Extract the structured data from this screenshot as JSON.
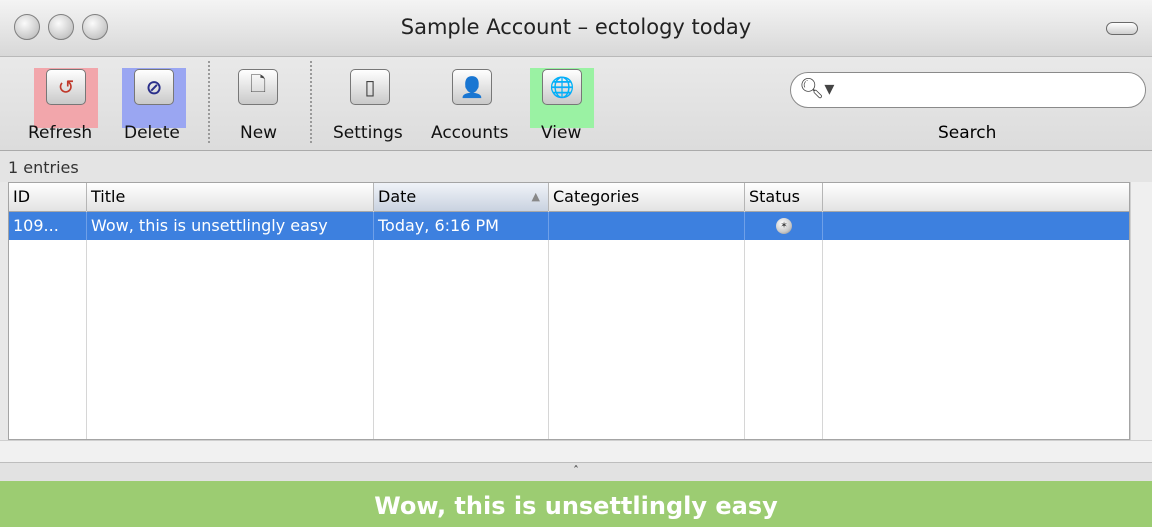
{
  "window": {
    "title": "Sample Account – ectology today"
  },
  "toolbar": {
    "refresh_label": "Refresh",
    "delete_label": "Delete",
    "new_label": "New",
    "settings_label": "Settings",
    "accounts_label": "Accounts",
    "view_label": "View",
    "search_label": "Search",
    "search_value": "",
    "refresh_icon": "↺",
    "delete_icon": "⊘",
    "new_icon": "🗋",
    "settings_icon": "▯",
    "accounts_icon": "👤",
    "view_icon": "🌐",
    "search_icon": "🔍︎▾",
    "highlight_colors": {
      "refresh": "#f2a6ab",
      "delete": "#9aa6f2",
      "view": "#9af2a3"
    }
  },
  "status": {
    "entry_count": "1 entries"
  },
  "table": {
    "columns": [
      {
        "label": "ID"
      },
      {
        "label": "Title"
      },
      {
        "label": "Date",
        "sorted": true
      },
      {
        "label": "Categories"
      },
      {
        "label": "Status"
      },
      {
        "label": ""
      }
    ],
    "rows": [
      {
        "id": "109...",
        "title": "Wow, this is unsettlingly easy",
        "date": "Today, 6:16 PM",
        "categories": "",
        "status": "posted-icon"
      }
    ]
  },
  "splitter": {
    "glyph": "ˆ"
  },
  "preview": {
    "text": "Wow, this is unsettlingly easy",
    "background": "#9ccc72"
  }
}
